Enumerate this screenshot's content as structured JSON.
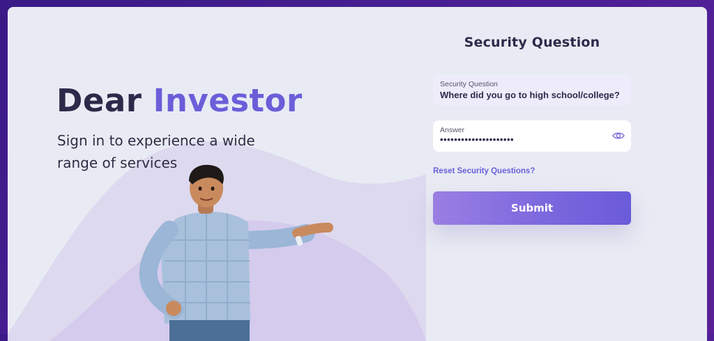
{
  "hero": {
    "title_main": "Dear",
    "title_accent": "Investor",
    "subtitle": "Sign in to experience a wide range of services"
  },
  "form": {
    "title": "Security Question",
    "question_label": "Security Question",
    "question_value": "Where did you go to high school/college?",
    "answer_label": "Answer",
    "answer_masked": "•••••••••••••••••••••",
    "reset_link": "Reset Security Questions?",
    "submit_label": "Submit"
  },
  "icons": {
    "eye": "eye-icon"
  },
  "colors": {
    "accent": "#6b5ed9",
    "background_frame": "#4b1f95",
    "card": "#e8ebf3",
    "heading": "#2c2a4a",
    "button_gradient_start": "#9a7ee3",
    "button_gradient_end": "#6a5bd9"
  }
}
